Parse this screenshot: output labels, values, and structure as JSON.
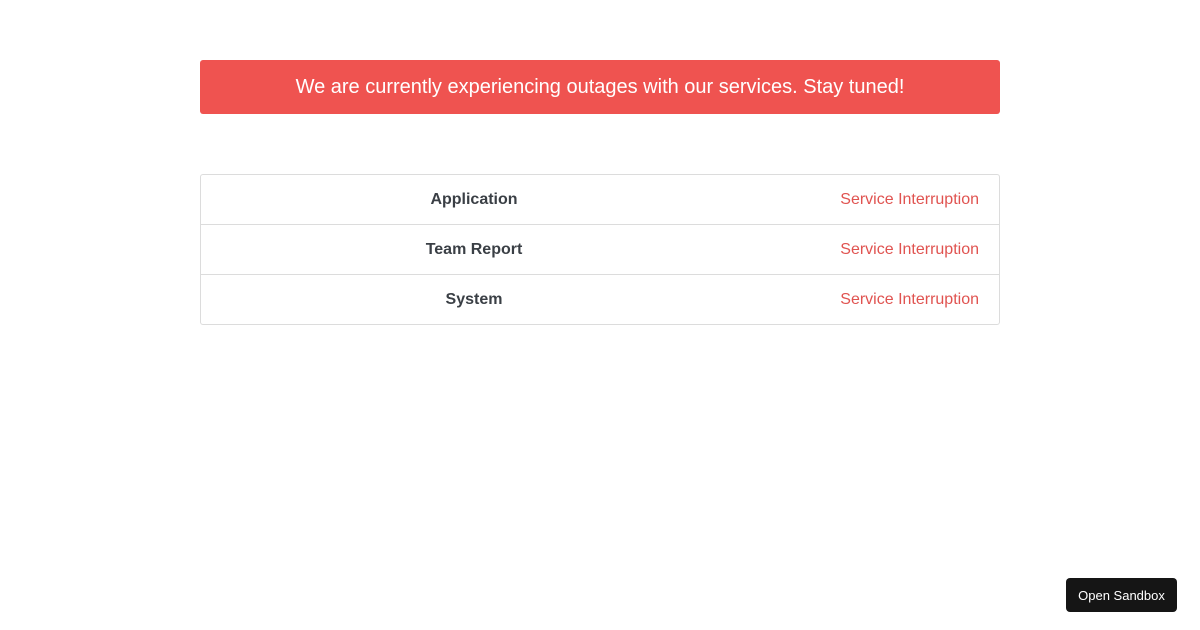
{
  "alert": {
    "message": "We are currently experiencing outages with our services. Stay tuned!",
    "color": "#ef5350"
  },
  "services": [
    {
      "name": "Application",
      "status": "Service Interruption"
    },
    {
      "name": "Team Report",
      "status": "Service Interruption"
    },
    {
      "name": "System",
      "status": "Service Interruption"
    }
  ],
  "status_color": "#e05350",
  "sandbox": {
    "label": "Open Sandbox"
  }
}
